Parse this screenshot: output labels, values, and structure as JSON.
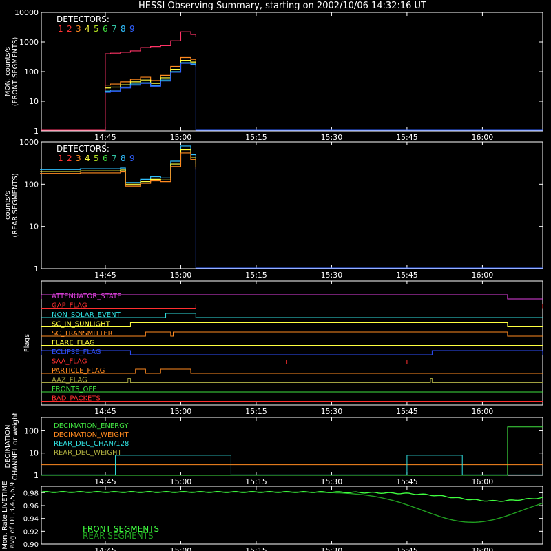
{
  "title": "HESSI Observing Summary, starting on 2002/10/06 14:32:16 UT",
  "time_ticks": [
    "14:45",
    "15:00",
    "15:15",
    "15:30",
    "15:45",
    "16:00"
  ],
  "detector_colors": [
    "#ff3333",
    "#ff3333",
    "#ff8a20",
    "#ffff40",
    "#b0e020",
    "#40e040",
    "#30c0a0",
    "#30c0ff",
    "#3060ff"
  ],
  "chart_data": [
    {
      "type": "line",
      "id": "front",
      "ylabel": "MON. counts/s",
      "ylabel2": "(FRONT SEGMENTS)",
      "yscale": "log",
      "ylim": [
        1,
        10000
      ],
      "xlim": [
        "14:32:16",
        "16:12"
      ],
      "yticks": [
        "1",
        "10",
        "100",
        "1000",
        "10000"
      ],
      "legend_title": "DETECTORS:",
      "legend_labels": [
        "1",
        "2",
        "3",
        "4",
        "5",
        "6",
        "7",
        "8",
        "9"
      ],
      "x": [
        "14:45",
        "14:46",
        "14:48",
        "14:50",
        "14:52",
        "14:54",
        "14:56",
        "14:58",
        "15:00",
        "15:02",
        "15:03"
      ],
      "series": [
        {
          "color": "#ff3366",
          "values": [
            400,
            420,
            450,
            500,
            650,
            700,
            750,
            1100,
            2200,
            1800,
            1500
          ]
        },
        {
          "color": "#ff8a20",
          "values": [
            35,
            38,
            45,
            55,
            65,
            50,
            75,
            150,
            300,
            260,
            200
          ]
        },
        {
          "color": "#ffff40",
          "values": [
            28,
            30,
            36,
            45,
            52,
            40,
            62,
            120,
            240,
            210,
            170
          ]
        },
        {
          "color": "#30c0ff",
          "values": [
            22,
            24,
            30,
            38,
            42,
            34,
            52,
            100,
            200,
            180,
            150
          ]
        },
        {
          "color": "#3060ff",
          "values": [
            20,
            22,
            28,
            35,
            40,
            32,
            48,
            95,
            190,
            170,
            140
          ]
        }
      ]
    },
    {
      "type": "line",
      "id": "rear",
      "ylabel": "counts/s",
      "ylabel2": "(REAR SEGMENTS)",
      "yscale": "log",
      "ylim": [
        1,
        1000
      ],
      "xlim": [
        "14:32:16",
        "16:12"
      ],
      "yticks": [
        "1",
        "10",
        "100",
        "1000"
      ],
      "legend_title": "DETECTORS:",
      "legend_labels": [
        "1",
        "2",
        "3",
        "4",
        "5",
        "6",
        "7",
        "8",
        "9"
      ],
      "x": [
        "14:32",
        "14:40",
        "14:48",
        "14:49",
        "14:52",
        "14:54",
        "14:56",
        "14:58",
        "15:00",
        "15:02",
        "15:03"
      ],
      "series": [
        {
          "color": "#30c0ff",
          "values": [
            220,
            230,
            240,
            110,
            130,
            150,
            140,
            350,
            800,
            500,
            300
          ]
        },
        {
          "color": "#ffff40",
          "values": [
            200,
            205,
            215,
            100,
            115,
            130,
            125,
            300,
            650,
            420,
            250
          ]
        },
        {
          "color": "#ff8a20",
          "values": [
            180,
            185,
            195,
            90,
            105,
            120,
            115,
            260,
            550,
            380,
            220
          ]
        }
      ]
    },
    {
      "type": "line",
      "id": "flags",
      "ylabel": "Flags",
      "flags": [
        {
          "label": "ATTENUATOR_STATE",
          "color": "#e040e0"
        },
        {
          "label": "GAP_FLAG",
          "color": "#ff3030"
        },
        {
          "label": "NON_SOLAR_EVENT",
          "color": "#30e0e0"
        },
        {
          "label": "SC_IN_SUNLIGHT",
          "color": "#ffff40"
        },
        {
          "label": "SC_TRANSMITTER",
          "color": "#ff8a20"
        },
        {
          "label": "FLARE_FLAG",
          "color": "#ffff40"
        },
        {
          "label": "ECLIPSE_FLAG",
          "color": "#3050ff"
        },
        {
          "label": "SAA_FLAG",
          "color": "#ff3030"
        },
        {
          "label": "PARTICLE_FLAG",
          "color": "#ff8a20"
        },
        {
          "label": "AAZ_FLAG",
          "color": "#a0a040"
        },
        {
          "label": "FRONTS_OFF",
          "color": "#40e040"
        },
        {
          "label": "BAD_PACKETS",
          "color": "#ff3030"
        }
      ]
    },
    {
      "type": "line",
      "id": "decimation",
      "ylabel": "DECIMATION",
      "ylabel2": "CHANNEL or weight",
      "yscale": "log",
      "ylim": [
        1,
        400
      ],
      "xlim": [
        "14:32:16",
        "16:12"
      ],
      "yticks": [
        "1",
        "10",
        "100"
      ],
      "series": [
        {
          "name": "DECIMATION_ENERGY",
          "color": "#40e040"
        },
        {
          "name": "DECIMATION_WEIGHT",
          "color": "#ff8a20"
        },
        {
          "name": "REAR_DEC_CHAN/128",
          "color": "#30e0e0"
        },
        {
          "name": "REAR_DEC_WEIGHT",
          "color": "#b0b040"
        }
      ]
    },
    {
      "type": "line",
      "id": "livetime",
      "ylabel": "Mon. Rate LIVETIME",
      "ylabel2": "avg of D1,3,4,5,6,9",
      "ylim": [
        0.9,
        0.99
      ],
      "xlim": [
        "14:32:16",
        "16:12"
      ],
      "yticks": [
        "0.90",
        "0.92",
        "0.94",
        "0.96",
        "0.98"
      ],
      "series": [
        {
          "name": "FRONT SEGMENTS",
          "color": "#40ff40"
        },
        {
          "name": "REAR SEGMENTS",
          "color": "#20a020"
        }
      ]
    }
  ]
}
